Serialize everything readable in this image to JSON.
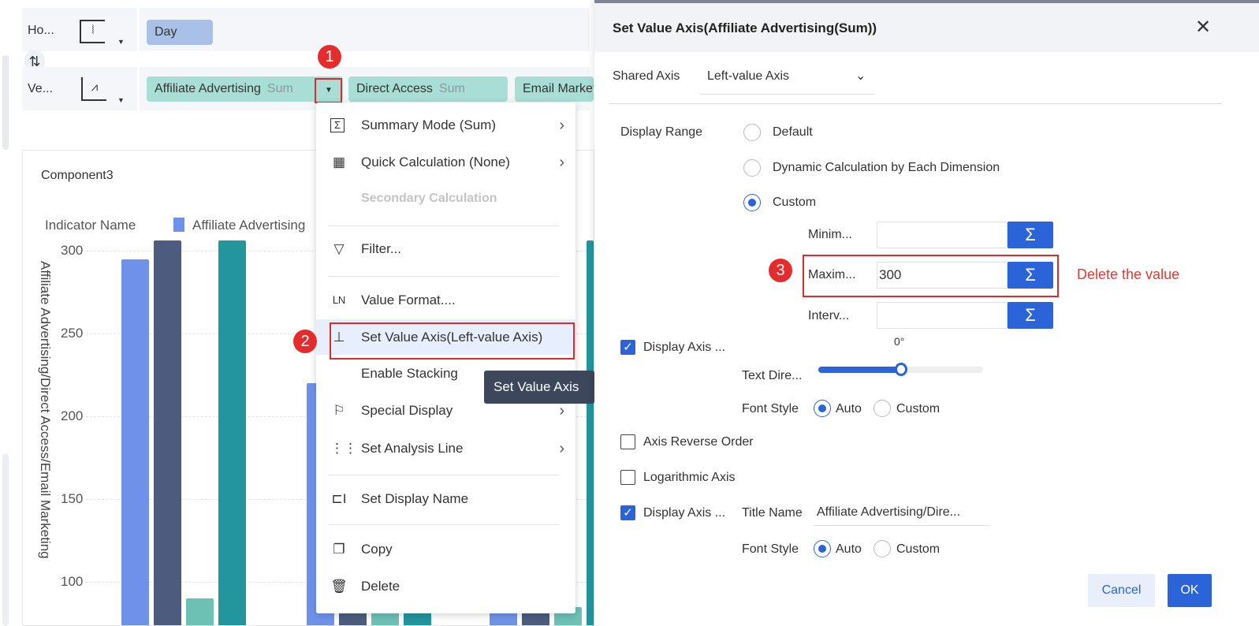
{
  "toolbar": {
    "horizontal_label": "Ho...",
    "vertical_label": "Ve...",
    "horizontal_fields": [
      {
        "name": "Day"
      }
    ],
    "vertical_fields": [
      {
        "name": "Affiliate Advertising",
        "agg": "Sum"
      },
      {
        "name": "Direct Access",
        "agg": "Sum"
      },
      {
        "name": "Email Marketing",
        "agg": ""
      }
    ]
  },
  "component": {
    "title": "Component3",
    "legend_title": "Indicator Name",
    "legend_item": "Affiliate Advertising"
  },
  "chart_data": {
    "type": "bar",
    "ylabel": "Affiliate Advertising/Direct Access/Email Marketing",
    "yticks": [
      300,
      250,
      200,
      150,
      100
    ],
    "ylim": [
      0,
      300
    ],
    "series_colors": [
      "#6e92ea",
      "#4b5c7e",
      "#6cc0b4",
      "#23959d"
    ],
    "groups": [
      {
        "values": [
          295,
          306,
          90,
          306
        ]
      },
      {
        "values": [
          220,
          85,
          85,
          85
        ]
      },
      {
        "values": [
          85,
          85,
          85,
          306
        ]
      }
    ]
  },
  "menu": {
    "items": [
      {
        "label": "Summary Mode (Sum)",
        "icon": "sigma-icon"
      },
      {
        "label": "Quick Calculation (None)",
        "icon": "calculator-icon"
      },
      {
        "label": "Secondary Calculation"
      },
      {
        "label": "Filter...",
        "icon": "filter-icon"
      },
      {
        "label": "Value Format....",
        "icon": "value-format-icon"
      },
      {
        "label": "Set Value Axis(Left-value Axis)",
        "icon": "axis-icon"
      },
      {
        "label": "Enable Stacking"
      },
      {
        "label": "Special Display",
        "icon": "flag-icon"
      },
      {
        "label": "Set Analysis Line",
        "icon": "analysis-line-icon"
      },
      {
        "label": "Set Display Name",
        "icon": "rename-icon"
      },
      {
        "label": "Copy",
        "icon": "copy-icon"
      },
      {
        "label": "Delete",
        "icon": "trash-icon"
      }
    ],
    "tooltip": "Set Value Axis"
  },
  "annotations": {
    "step1": "1",
    "step2": "2",
    "step3": "3",
    "note": "Delete the value"
  },
  "dialog": {
    "title": "Set Value Axis(Affiliate Advertising(Sum))",
    "shared_axis_label": "Shared Axis",
    "shared_axis_value": "Left-value Axis",
    "display_range_label": "Display Range",
    "range_options": [
      "Default",
      "Dynamic Calculation by Each Dimension",
      "Custom"
    ],
    "min_label": "Minim...",
    "min_value": "",
    "max_label": "Maxim...",
    "max_value": "300",
    "interval_label": "Interv...",
    "interval_value": "",
    "angle_value": "0°",
    "display_axis_label": "Display Axis ...",
    "text_direction_label": "Text Dire...",
    "text_direction_fraction": 0.5,
    "font_style_label": "Font Style",
    "auto_label": "Auto",
    "custom_label": "Custom",
    "axis_reverse_label": "Axis Reverse Order",
    "log_axis_label": "Logarithmic Axis",
    "display_axis_title_label": "Display Axis ...",
    "title_name_label": "Title Name",
    "title_name_value": "Affiliate Advertising/Dire...",
    "cancel": "Cancel",
    "ok": "OK"
  }
}
